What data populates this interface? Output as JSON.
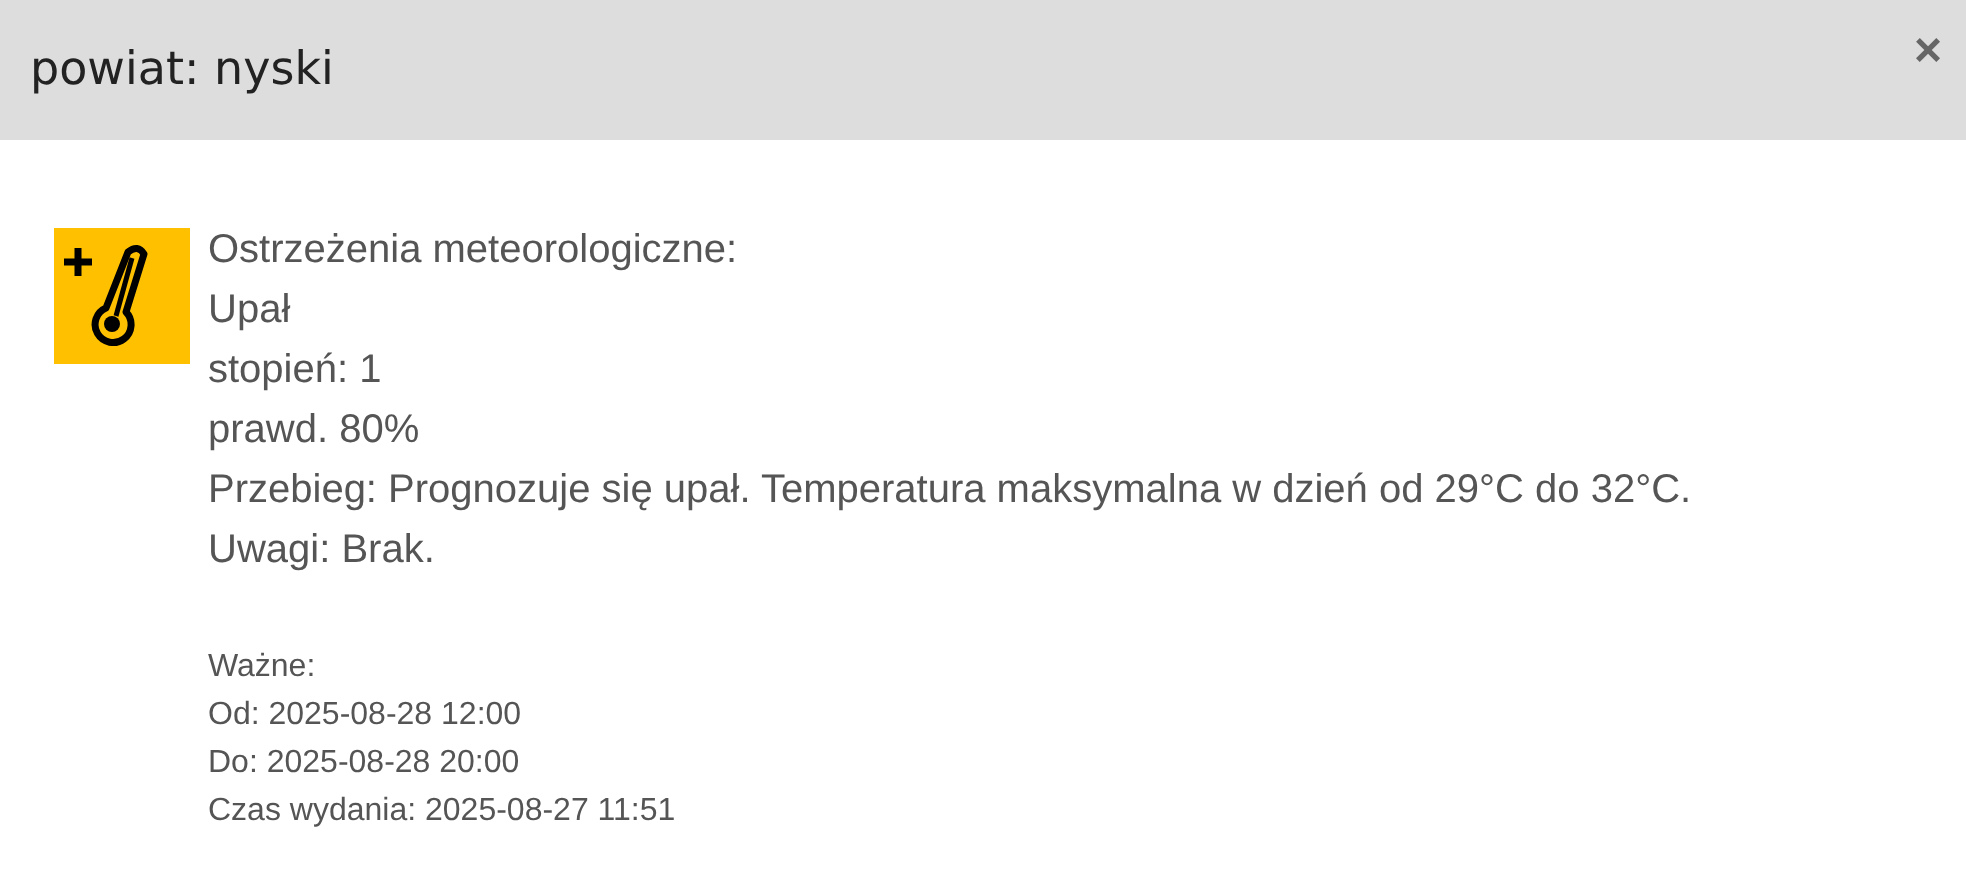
{
  "dialog": {
    "title": "powiat: nyski",
    "close": "×"
  },
  "warning": {
    "heading": "Ostrzeżenia meteorologiczne:",
    "type": "Upał",
    "level": "stopień: 1",
    "probability": "prawd. 80%",
    "course": "Przebieg: Prognozuje się upał. Temperatura maksymalna w dzień od 29°C do 32°C.",
    "remarks": "Uwagi: Brak."
  },
  "validity": [
    "Ważne:",
    "Od: 2025-08-28 12:00",
    "Do: 2025-08-28 20:00",
    "Czas wydania: 2025-08-27 11:51"
  ]
}
